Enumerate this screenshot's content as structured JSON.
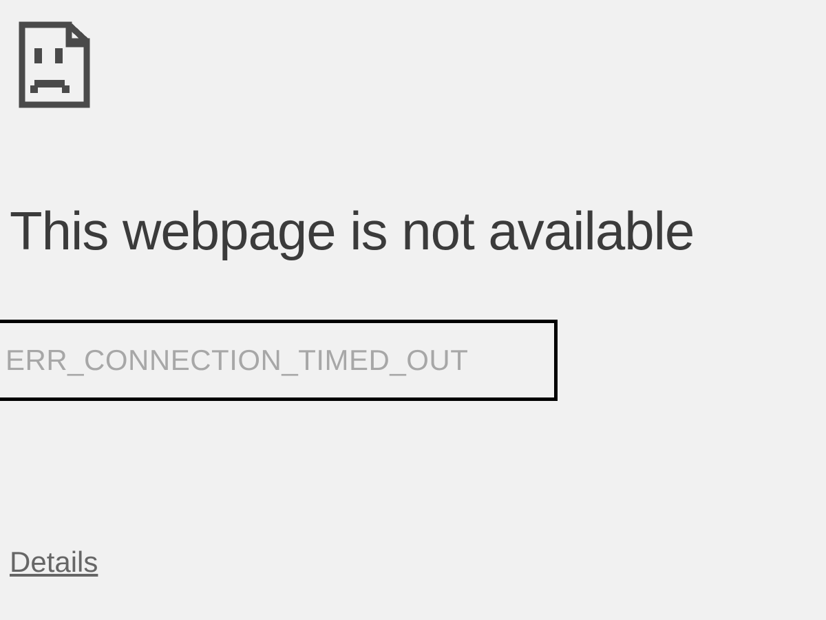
{
  "error": {
    "title": "This webpage is not available",
    "code": "ERR_CONNECTION_TIMED_OUT",
    "details_link": "Details"
  }
}
